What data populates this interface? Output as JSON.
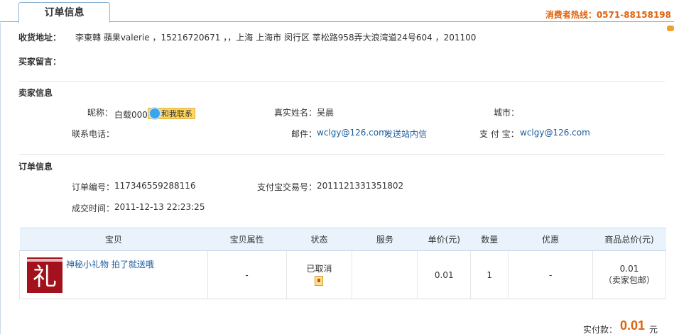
{
  "header": {
    "tab_label": "订单信息",
    "hotline": "消费者热线：0571-88158198"
  },
  "shipping": {
    "label": "收货地址：",
    "value": "李東轉 蘋果valerie ，15216720671 ，，上海 上海市 闵行区 莘松路958弄大浪湾道24号604 ，201100"
  },
  "buyer_message": {
    "label": "买家留言："
  },
  "seller": {
    "section_title": "卖家信息",
    "nickname_label": "昵称：",
    "nickname": "白载000",
    "contact_button": "和我联系",
    "realname_label": "真实姓名：",
    "realname": "吴晨",
    "city_label": "城市：",
    "city": "",
    "phone_label": "联系电话：",
    "phone": "",
    "email_label": "邮件：",
    "email": "wclgy@126.com",
    "send_msg_link": "发送站内信",
    "alipay_label": "支 付 宝：",
    "alipay": "wclgy@126.com"
  },
  "order": {
    "section_title": "订单信息",
    "order_no_label": "订单编号：",
    "order_no": "117346559288116",
    "alipay_trade_label": "支付宝交易号：",
    "alipay_trade_no": "2011121331351802",
    "deal_time_label": "成交时间：",
    "deal_time": "2011-12-13 22:23:25"
  },
  "items_table": {
    "headers": [
      "宝贝",
      "宝贝属性",
      "状态",
      "服务",
      "单价(元)",
      "数量",
      "优惠",
      "商品总价(元)"
    ],
    "rows": [
      {
        "thumb_char": "礼",
        "title": "神秘小礼物 拍了就送哦",
        "attributes": "-",
        "status": "已取消",
        "service": "",
        "unit_price": "0.01",
        "quantity": "1",
        "discount": "-",
        "total": "0.01",
        "total_note": "（卖家包邮）"
      }
    ]
  },
  "payment": {
    "label": "实付款：",
    "amount": "0.01",
    "unit": "元"
  }
}
